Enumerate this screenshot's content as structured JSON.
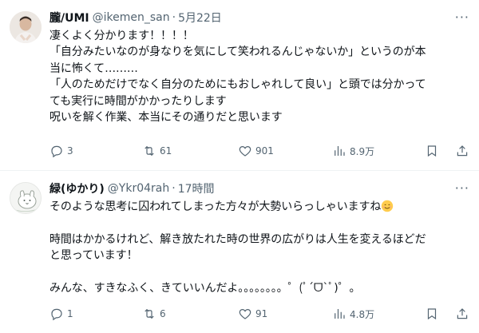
{
  "tweets": [
    {
      "name": "朧/UMI",
      "handle": "@ikemen_san",
      "separator": "·",
      "time": "5月22日",
      "more": "···",
      "lines": [
        "凄くよく分かります！！！！",
        "「自分みたいなのが身なりを気にして笑われるんじゃないか」というのが本",
        "当に怖くて………",
        "「人のためだけでなく自分のためにもおしゃれして良い」と頭では分かって",
        "ても実行に時間がかかったりします",
        "呪いを解く作業、本当にその通りだと思います"
      ],
      "stats": {
        "replies": "3",
        "reposts": "61",
        "likes": "901",
        "views": "8.9万"
      }
    },
    {
      "name": "緑(ゆかり)",
      "handle": "@Ykr04rah",
      "separator": "·",
      "time": "17時間",
      "more": "···",
      "line1": "そのような思考に囚われてしまった方々が大勢いらっしゃいますね",
      "line2": "時間はかかるけれど、解き放たれた時の世界の広がりは人生を変えるほどだ",
      "line3": "と思っています！",
      "line4": "みんな、すきなふく、きていいんだよ。。。。。。。。゜(ﾟ´ᗜ`ﾟ)゜。",
      "stats": {
        "replies": "1",
        "reposts": "6",
        "likes": "91",
        "views": "4.8万"
      }
    }
  ],
  "icons": {
    "reply": "reply-icon",
    "repost": "repost-icon",
    "like": "heart-icon",
    "views": "views-icon",
    "bookmark": "bookmark-icon",
    "share": "share-icon"
  },
  "colors": {
    "text": "#0f1419",
    "secondary": "#536471",
    "divider": "#eff3f4"
  }
}
